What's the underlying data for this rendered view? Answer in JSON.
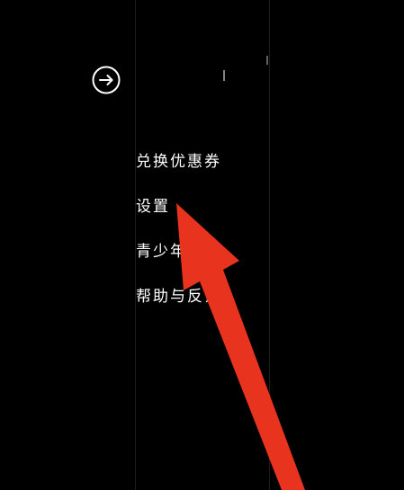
{
  "header": {
    "exit_icon": "arrow-right-circle-icon"
  },
  "menu": {
    "items": [
      {
        "label": "兑换优惠券"
      },
      {
        "label": "设置"
      },
      {
        "label": "青少年模式"
      },
      {
        "label": "帮助与反馈"
      }
    ]
  },
  "annotation": {
    "arrow_color": "#e8331f",
    "points_to": "设置"
  },
  "colors": {
    "background": "#000000",
    "text": "#ffffff",
    "accent": "#e8331f"
  }
}
